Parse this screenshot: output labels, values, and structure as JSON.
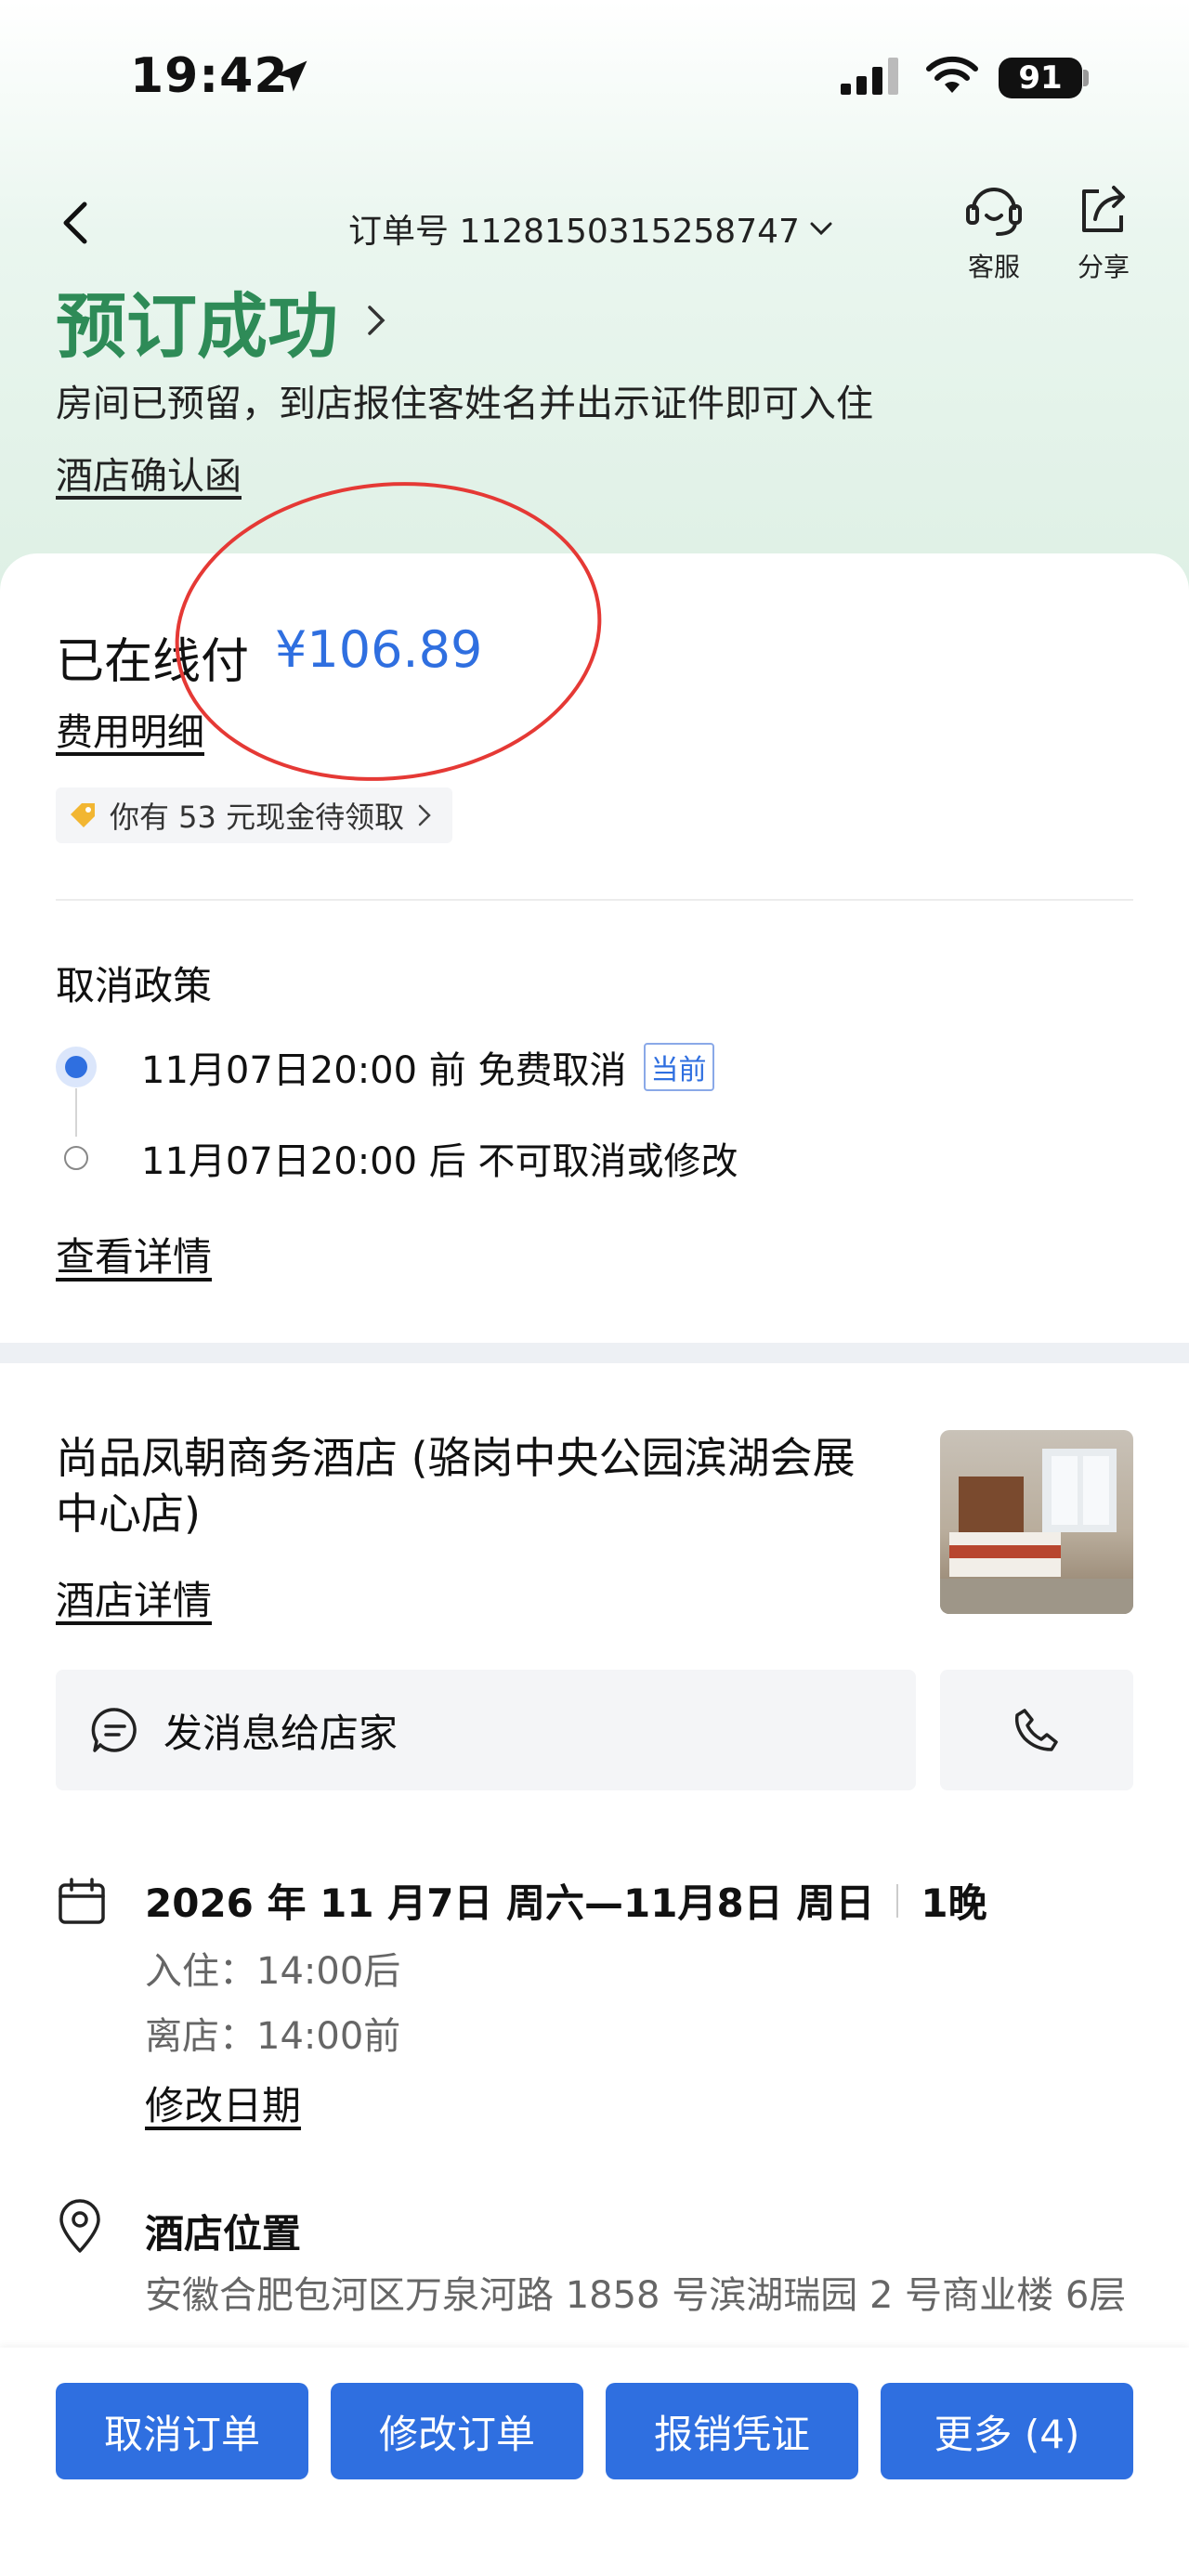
{
  "status_bar": {
    "time": "19:42",
    "battery": "91"
  },
  "nav": {
    "order_number": "订单号 1128150315258747",
    "customer_service_label": "客服",
    "share_label": "分享"
  },
  "header": {
    "title": "预订成功",
    "subtitle": "房间已预留，到店报住客姓名并出示证件即可入住",
    "confirm_link": "酒店确认函"
  },
  "payment": {
    "label": "已在线付",
    "amount": "¥106.89",
    "fee_detail_link": "费用明细",
    "cash_badge": "你有 53 元现金待领取"
  },
  "cancel_policy": {
    "title": "取消政策",
    "items": [
      {
        "text": "11月07日20:00 前 免费取消",
        "tag": "当前"
      },
      {
        "text": "11月07日20:00 后 不可取消或修改"
      }
    ],
    "detail_link": "查看详情"
  },
  "hotel": {
    "name": "尚品凤朝商务酒店 (骆岗中央公园滨湖会展中心店)",
    "detail_link": "酒店详情",
    "message_button": "发消息给店家"
  },
  "stay": {
    "dates": "2026 年 11 月7日 周六—11月8日 周日",
    "nights": "1晚",
    "checkin": "入住：14:00后",
    "checkout": "离店：14:00前",
    "modify_link": "修改日期"
  },
  "location": {
    "title": "酒店位置",
    "address": "安徽合肥包河区万泉河路 1858 号滨湖瑞园 2 号商业楼 6层"
  },
  "actions": {
    "cancel": "取消订单",
    "modify": "修改订单",
    "invoice": "报销凭证",
    "more": "更多 (4)"
  },
  "colors": {
    "accent": "#2f6fe0",
    "success": "#2e8b57",
    "annotation": "#e53935"
  }
}
